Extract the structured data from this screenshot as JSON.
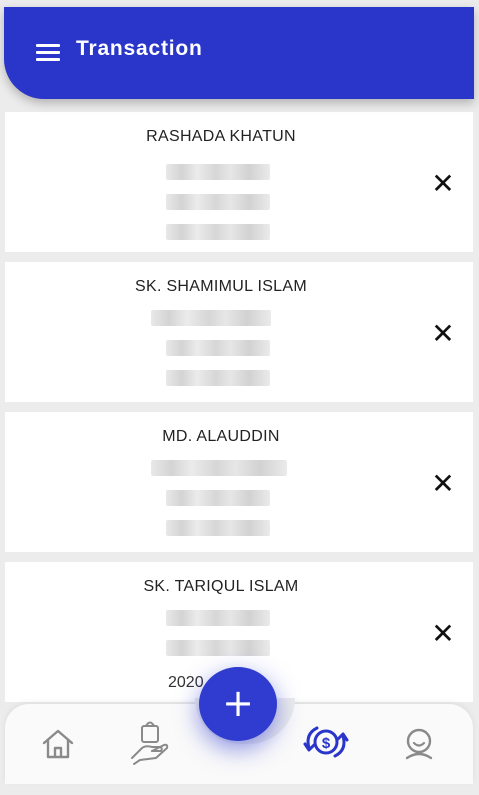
{
  "header": {
    "title": "Transaction",
    "menu_icon": "hamburger-menu-icon",
    "color": "#2a35c9"
  },
  "transactions": [
    {
      "name": "RASHADA KHATUN"
    },
    {
      "name": "SK. SHAMIMUL ISLAM"
    },
    {
      "name": "MD. ALAUDDIN"
    },
    {
      "name": "SK. TARIQUL ISLAM",
      "date_partial": "2020"
    }
  ],
  "close_symbol": "✕",
  "fab": {
    "symbol": "+"
  },
  "bottom_nav": {
    "items": [
      {
        "icon": "home-icon",
        "active": false
      },
      {
        "icon": "shopping-bag-hand-icon",
        "active": false
      },
      {
        "icon": "dollar-exchange-icon",
        "active": true
      },
      {
        "icon": "profile-icon",
        "active": false
      }
    ],
    "active_color": "#2a35c9",
    "inactive_color": "#8a8a8a"
  }
}
